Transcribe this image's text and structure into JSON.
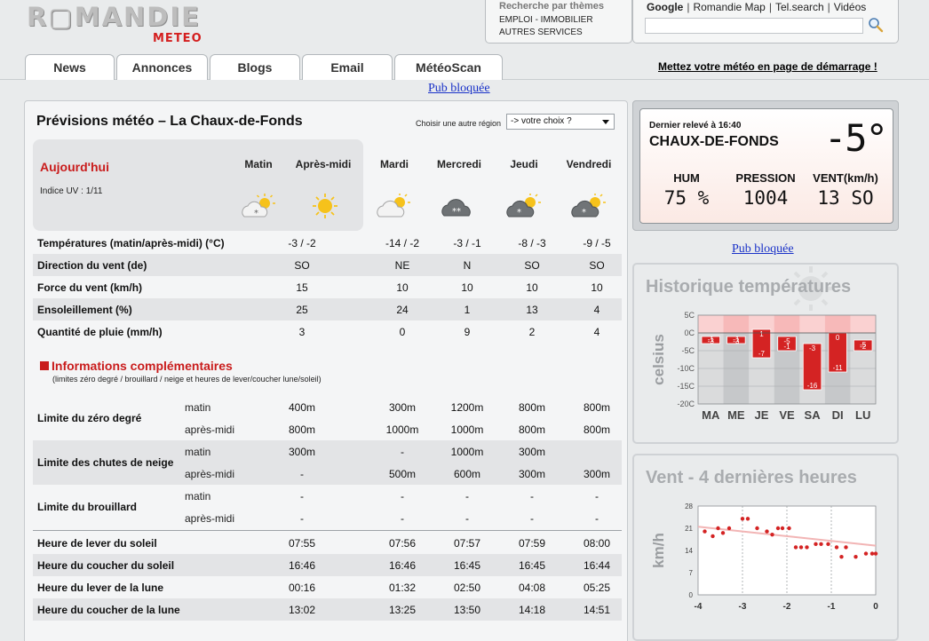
{
  "header": {
    "logo_main": "R▢MANDIE",
    "logo_sub": "METEO",
    "themes": {
      "title": "Recherche par thèmes",
      "links": [
        "EMPLOI - IMMOBILIER",
        "AUTRES SERVICES"
      ]
    },
    "search": {
      "links": [
        "Google",
        "Romandie Map",
        "Tel.search",
        "Vidéos"
      ],
      "selected": "Google",
      "value": "",
      "placeholder": ""
    },
    "tabs": [
      "News",
      "Annonces",
      "Blogs",
      "Email",
      "MétéoScan"
    ],
    "startpage_link": "Mettez votre météo en page de démarrage !"
  },
  "pub_top": "Pub bloquée",
  "pub_right": "Pub bloquée",
  "forecast": {
    "title": "Prévisions météo – La Chaux-de-Fonds",
    "region_label": "Choisir une autre région",
    "region_value": "-> votre choix ?",
    "today_label": "Aujourd'hui",
    "uv": "Indice UV : 1/11",
    "columns": [
      "Matin",
      "Après-midi",
      "Mardi",
      "Mercredi",
      "Jeudi",
      "Vendredi"
    ],
    "icons": [
      "snow-sun-icon",
      "sunny-icon",
      "sun-cloud-icon",
      "snow-cloud-icon",
      "snow-sun-icon",
      "snow-sun-icon"
    ],
    "rows": [
      {
        "label": "Températures (matin/après-midi) (°C)",
        "values": [
          "-3 / -2",
          "-14 / -2",
          "-3 / -1",
          "-8 / -3",
          "-9 / -5"
        ]
      },
      {
        "label": "Direction du vent (de)",
        "values": [
          "SO",
          "NE",
          "N",
          "SO",
          "SO"
        ]
      },
      {
        "label": "Force du vent (km/h)",
        "values": [
          "15",
          "10",
          "10",
          "10",
          "10"
        ]
      },
      {
        "label": "Ensoleillement (%)",
        "values": [
          "25",
          "24",
          "1",
          "13",
          "4"
        ]
      },
      {
        "label": "Quantité de pluie (mm/h)",
        "values": [
          "3",
          "0",
          "9",
          "2",
          "4"
        ]
      }
    ],
    "info_title": "Informations complémentaires",
    "info_subtitle": "(limites zéro degré / brouillard / neige et heures de lever/coucher lune/soleil)",
    "groups": [
      {
        "label": "Limite du zéro degré",
        "matin": [
          "400m",
          "300m",
          "1200m",
          "800m",
          "800m"
        ],
        "apres_midi": [
          "800m",
          "1000m",
          "1000m",
          "800m",
          "800m"
        ]
      },
      {
        "label": "Limite des chutes de neige",
        "matin": [
          "300m",
          "-",
          "1000m",
          "300m",
          ""
        ],
        "apres_midi": [
          "-",
          "500m",
          "600m",
          "300m",
          "300m"
        ]
      },
      {
        "label": "Limite du brouillard",
        "matin": [
          "-",
          "-",
          "-",
          "-",
          "-"
        ],
        "apres_midi": [
          "-",
          "-",
          "-",
          "-",
          "-"
        ]
      }
    ],
    "sub_labels": [
      "matin",
      "après-midi"
    ],
    "sun_rows": [
      {
        "label": "Heure de lever du soleil",
        "values": [
          "07:55",
          "07:56",
          "07:57",
          "07:59",
          "08:00"
        ]
      },
      {
        "label": "Heure du coucher du soleil",
        "values": [
          "16:46",
          "16:46",
          "16:45",
          "16:45",
          "16:44"
        ]
      },
      {
        "label": "Heure du lever de la lune",
        "values": [
          "00:16",
          "01:32",
          "02:50",
          "04:08",
          "05:25"
        ]
      },
      {
        "label": "Heure du coucher de la lune",
        "values": [
          "13:02",
          "13:25",
          "13:50",
          "14:18",
          "14:51"
        ]
      }
    ]
  },
  "current": {
    "label": "Dernier relevé à 16:40",
    "city": "CHAUX-DE-FONDS",
    "temp": "-5°",
    "heads": [
      "HUM",
      "PRESSION",
      "VENT(km/h)"
    ],
    "values": [
      "75 %",
      "1004",
      "13 SO"
    ]
  },
  "colors": {
    "accent_red": "#c91c1c",
    "bar_red": "#d42323",
    "link_blue": "#1a32c8"
  },
  "chart_data": [
    {
      "type": "bar",
      "title": "Historique températures",
      "ylabel": "celsius",
      "categories": [
        "MA",
        "ME",
        "JE",
        "VE",
        "SA",
        "DI",
        "LU"
      ],
      "ylim": [
        -20,
        5
      ],
      "yticks": [
        "5C",
        "0C",
        "-5C",
        "-10C",
        "-15C",
        "-20C"
      ],
      "series": [
        {
          "values": [
            -3,
            -3,
            1,
            -5,
            -3,
            0,
            -5
          ]
        },
        {
          "values": [
            -1,
            -1,
            -7,
            -1,
            -16,
            -11,
            -2
          ]
        }
      ],
      "labels": [
        [
          "-3",
          "-1"
        ],
        [
          "-3",
          "-1"
        ],
        [
          "1",
          "-7"
        ],
        [
          "-5",
          "-1"
        ],
        [
          "-3",
          "-16"
        ],
        [
          "0",
          "-11"
        ],
        [
          "-5",
          "-2"
        ]
      ],
      "grid": true
    },
    {
      "type": "scatter",
      "title": "Vent - 4 dernières heures",
      "ylabel": "km/h",
      "xlim": [
        -4,
        0
      ],
      "ylim": [
        0,
        28
      ],
      "xticks": [
        "-4",
        "-3",
        "-2",
        "-1",
        "0"
      ],
      "yticks": [
        "28",
        "21",
        "14",
        "7",
        "0"
      ],
      "x": [
        -3.85,
        -3.67,
        -3.55,
        -3.44,
        -3.3,
        -3.0,
        -2.88,
        -2.67,
        -2.45,
        -2.33,
        -2.2,
        -2.1,
        -1.95,
        -1.8,
        -1.68,
        -1.55,
        -1.35,
        -1.23,
        -1.07,
        -0.88,
        -0.77,
        -0.67,
        -0.45,
        -0.22,
        -0.08,
        0.0
      ],
      "y": [
        20,
        18.5,
        21,
        19.5,
        21,
        24,
        24,
        21,
        20,
        19,
        21,
        21,
        21,
        15,
        15,
        15,
        16,
        16,
        16,
        15,
        12,
        15,
        12,
        13,
        13,
        13
      ],
      "trend": [
        [
          -4,
          21.5
        ],
        [
          0,
          15.5
        ]
      ],
      "grid": true
    }
  ]
}
